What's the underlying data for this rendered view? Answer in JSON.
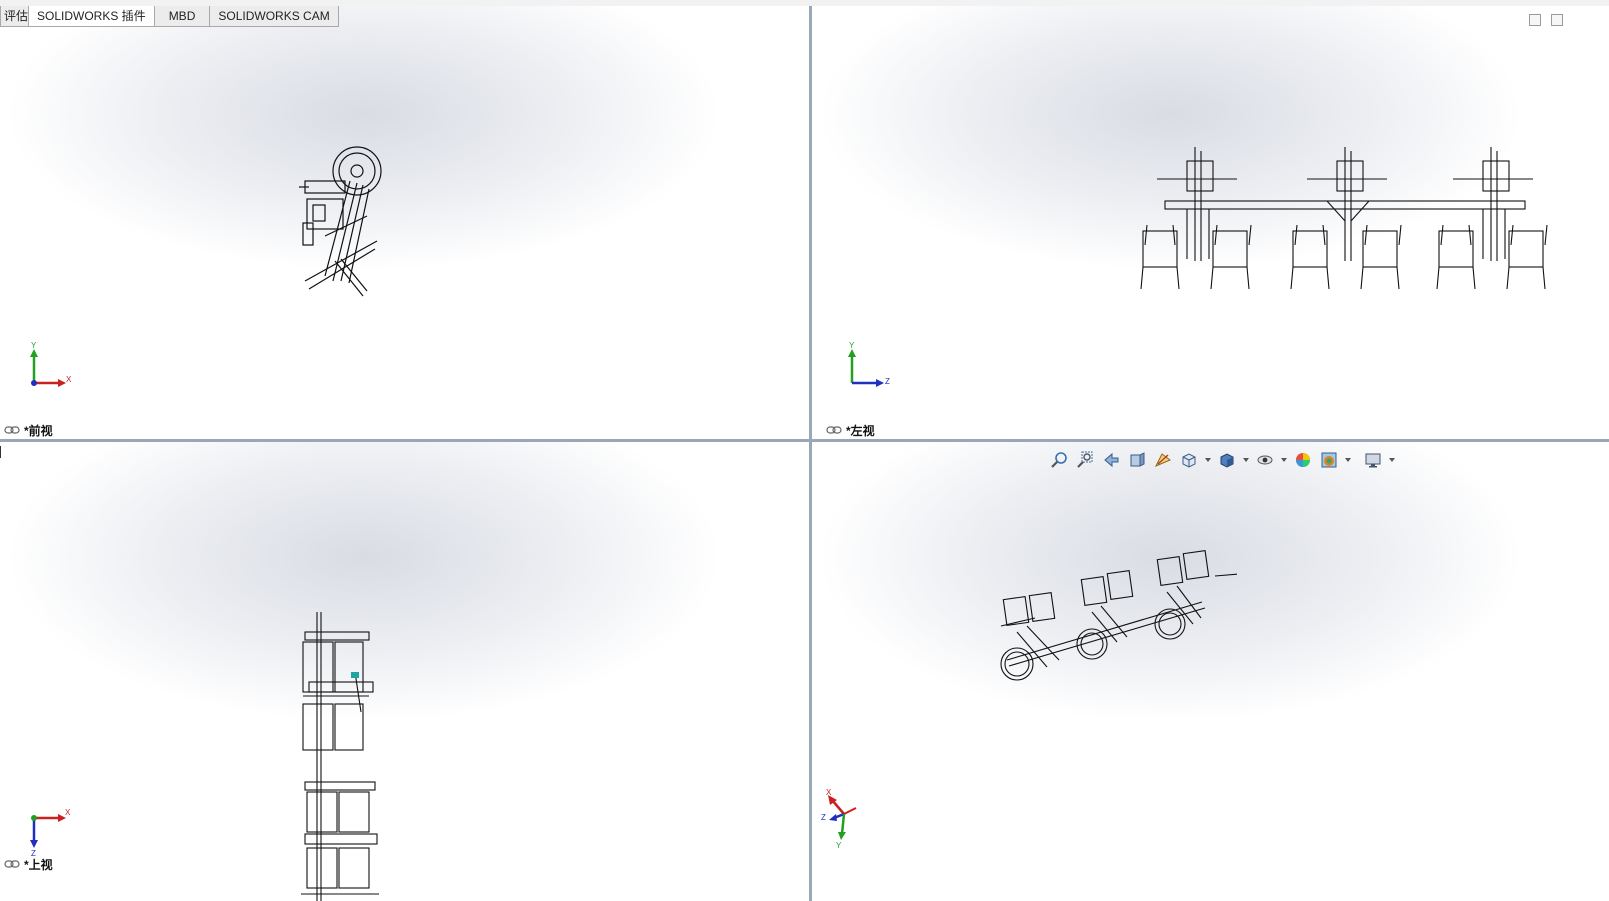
{
  "tabs": [
    {
      "label": "评估",
      "active": false
    },
    {
      "label": "SOLIDWORKS 插件",
      "active": true
    },
    {
      "label": "MBD",
      "active": false
    },
    {
      "label": "SOLIDWORKS CAM",
      "active": false
    }
  ],
  "viewports": {
    "front": {
      "label": "*前视",
      "triad": {
        "up": "Y",
        "right": "X"
      }
    },
    "left": {
      "label": "*左视",
      "triad": {
        "up": "Y",
        "right": "Z"
      }
    },
    "top": {
      "label": "*上视",
      "triad": {
        "up": "X",
        "down": "Z"
      }
    },
    "iso": {
      "triad": {
        "a": "X",
        "b": "Z",
        "c": "Y"
      }
    }
  },
  "heads_up_toolbar": {
    "icons": [
      "zoom-to-fit-icon",
      "zoom-to-area-icon",
      "previous-view-icon",
      "section-view-icon",
      "dynamic-annotation-icon",
      "view-orientation-icon",
      "display-style-icon",
      "hide-show-items-icon",
      "edit-appearance-icon",
      "apply-scene-icon",
      "view-settings-icon"
    ]
  },
  "colors": {
    "axis_x": "#cc2020",
    "axis_y": "#22a022",
    "axis_z": "#1f2fbf",
    "splitter": "#9aa7b8"
  }
}
